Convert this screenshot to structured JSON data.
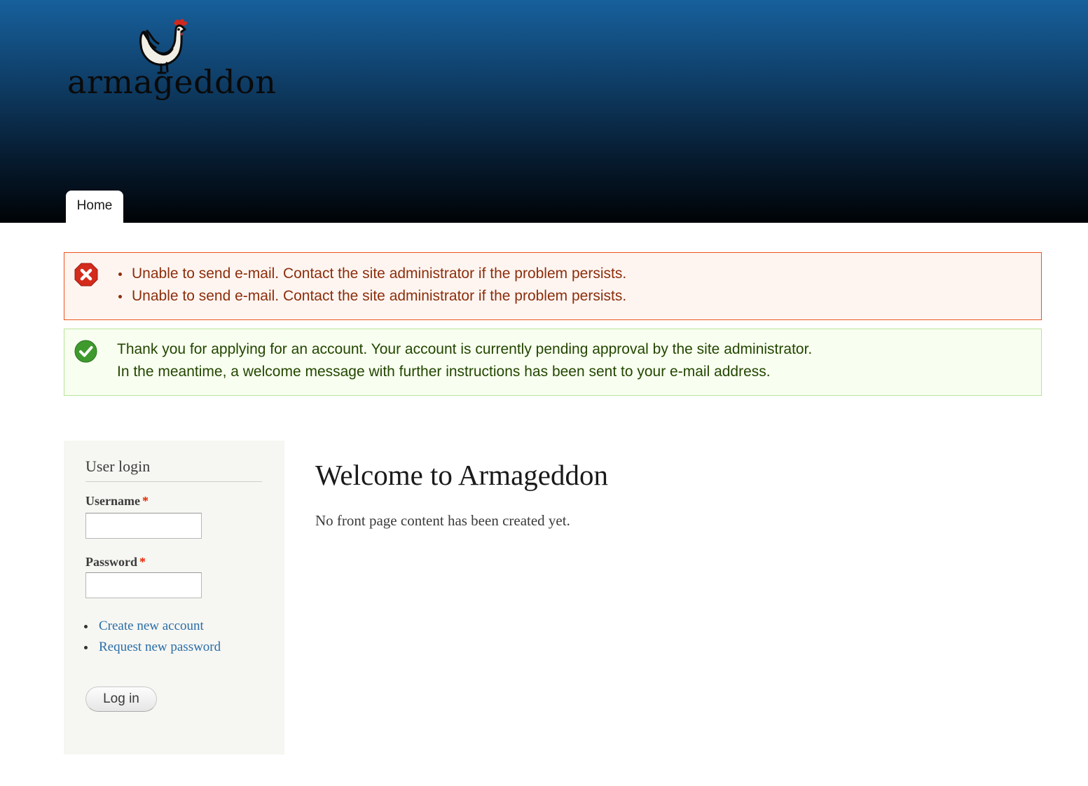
{
  "header": {
    "site_name": "armageddon",
    "logo_icon": "rooster-icon",
    "nav": [
      {
        "label": "Home",
        "active": true
      }
    ]
  },
  "messages": {
    "error": {
      "icon": "error-icon",
      "items": [
        "Unable to send e-mail. Contact the site administrator if the problem persists.",
        "Unable to send e-mail. Contact the site administrator if the problem persists."
      ]
    },
    "status": {
      "icon": "check-icon",
      "lines": [
        "Thank you for applying for an account. Your account is currently pending approval by the site administrator.",
        "In the meantime, a welcome message with further instructions has been sent to your e-mail address."
      ]
    }
  },
  "sidebar": {
    "title": "User login",
    "username_label": "Username",
    "password_label": "Password",
    "required_marker": "*",
    "username_value": "",
    "password_value": "",
    "links": [
      {
        "label": "Create new account"
      },
      {
        "label": "Request new password"
      }
    ],
    "login_button": "Log in"
  },
  "main": {
    "title": "Welcome to Armageddon",
    "body": "No front page content has been created yet."
  },
  "colors": {
    "error_border": "#ed541d",
    "error_bg": "#fef5f1",
    "status_border": "#b8e39a",
    "status_bg": "#f8fff0",
    "link": "#2a6ea8",
    "required": "#e32700"
  }
}
